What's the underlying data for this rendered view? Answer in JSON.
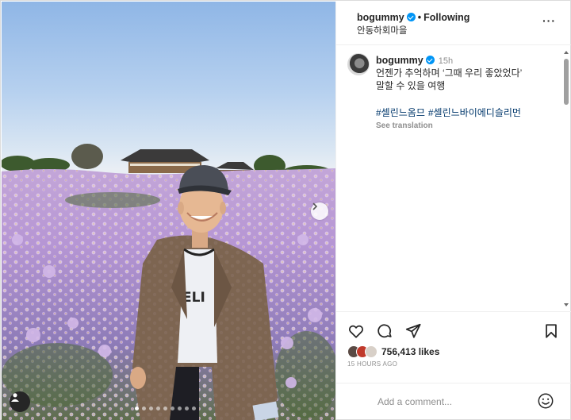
{
  "post": {
    "username": "bogummy",
    "follow_label": "Following",
    "separator": "•",
    "location": "안동하회마을",
    "more_label": "···"
  },
  "comment": {
    "username": "bogummy",
    "time": "15h",
    "text": "언젠가 추억하며 ‘그때 우리 좋았었다’\n말할 수 있을 여행",
    "hashtags": [
      "#셀린느옴므",
      "#셀린느바이에디슬리먼"
    ],
    "see_translation": "See translation"
  },
  "likes": {
    "count_text": "756,413 likes",
    "posted_ago": "15 HOURS AGO"
  },
  "add_comment": {
    "placeholder": "Add a comment..."
  },
  "carousel": {
    "total_dots": 9,
    "active_index": 0
  },
  "icons": [
    "heart-icon",
    "comment-icon",
    "share-icon",
    "bookmark-icon",
    "emoji-icon",
    "more-icon",
    "verified-badge-icon",
    "chevron-right-icon",
    "user-tag-icon"
  ],
  "colors": {
    "verified_blue": "#0095f6",
    "hashtag_blue": "#00376b",
    "muted_gray": "#8e8e8e",
    "text": "#262626"
  }
}
